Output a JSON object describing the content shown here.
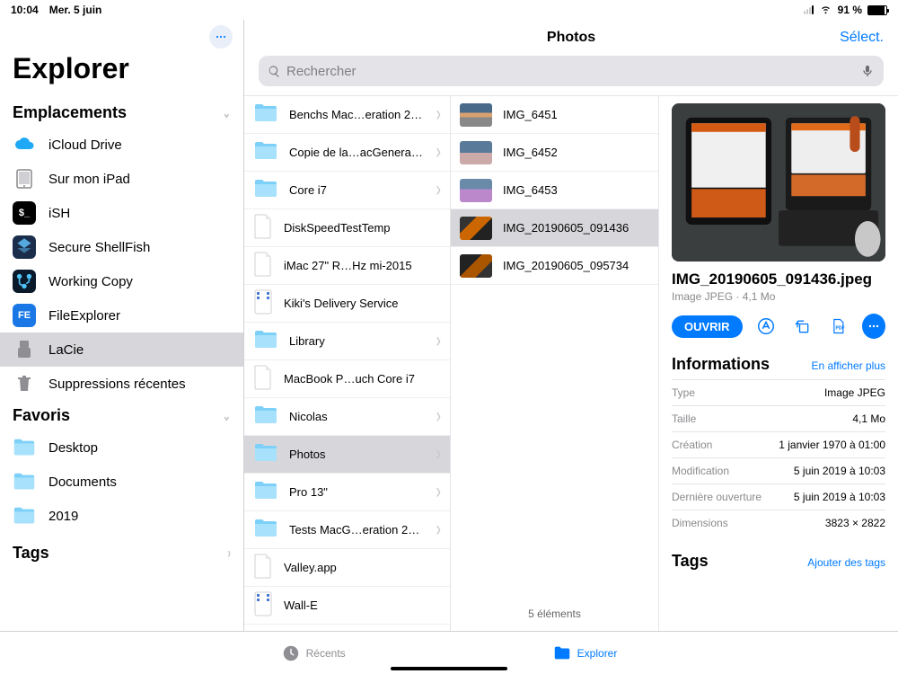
{
  "status": {
    "time": "10:04",
    "date": "Mer. 5 juin",
    "battery_pct": "91 %"
  },
  "sidebar": {
    "title": "Explorer",
    "locations_label": "Emplacements",
    "favorites_label": "Favoris",
    "tags_label": "Tags",
    "locations": [
      {
        "label": "iCloud Drive",
        "icon": "cloud"
      },
      {
        "label": "Sur mon iPad",
        "icon": "ipad"
      },
      {
        "label": "iSH",
        "icon": "ish"
      },
      {
        "label": "Secure ShellFish",
        "icon": "shellfish"
      },
      {
        "label": "Working Copy",
        "icon": "working-copy"
      },
      {
        "label": "FileExplorer",
        "icon": "fe"
      },
      {
        "label": "LaCie",
        "icon": "usb",
        "selected": true
      },
      {
        "label": "Suppressions récentes",
        "icon": "trash"
      }
    ],
    "favorites": [
      {
        "label": "Desktop"
      },
      {
        "label": "Documents"
      },
      {
        "label": "2019"
      }
    ]
  },
  "header": {
    "title": "Photos",
    "select": "Sélect.",
    "search_placeholder": "Rechercher"
  },
  "column1": [
    {
      "label": "Benchs Mac…eration 2011",
      "type": "folder"
    },
    {
      "label": "Copie de la…acGeneration",
      "type": "folder"
    },
    {
      "label": "Core i7",
      "type": "folder"
    },
    {
      "label": "DiskSpeedTestTemp",
      "type": "file"
    },
    {
      "label": "iMac 27\" R…Hz mi-2015",
      "type": "file"
    },
    {
      "label": "Kiki's Delivery Service",
      "type": "video"
    },
    {
      "label": "Library",
      "type": "folder"
    },
    {
      "label": "MacBook P…uch Core i7",
      "type": "file"
    },
    {
      "label": "Nicolas",
      "type": "folder"
    },
    {
      "label": "Photos",
      "type": "folder",
      "selected": true
    },
    {
      "label": "Pro 13\"",
      "type": "folder"
    },
    {
      "label": "Tests MacG…eration 2014",
      "type": "folder"
    },
    {
      "label": "Valley.app",
      "type": "file"
    },
    {
      "label": "Wall-E",
      "type": "video"
    }
  ],
  "column2": [
    {
      "label": "IMG_6451"
    },
    {
      "label": "IMG_6452"
    },
    {
      "label": "IMG_6453"
    },
    {
      "label": "IMG_20190605_091436",
      "selected": true
    },
    {
      "label": "IMG_20190605_095734"
    }
  ],
  "column2_footer": "5 éléments",
  "detail": {
    "filename": "IMG_20190605_091436.jpeg",
    "subtitle": "Image JPEG · 4,1 Mo",
    "open_label": "OUVRIR",
    "info_title": "Informations",
    "info_more": "En afficher plus",
    "rows": [
      {
        "k": "Type",
        "v": "Image JPEG"
      },
      {
        "k": "Taille",
        "v": "4,1 Mo"
      },
      {
        "k": "Création",
        "v": "1 janvier 1970 à 01:00"
      },
      {
        "k": "Modification",
        "v": "5 juin 2019 à 10:03"
      },
      {
        "k": "Dernière ouverture",
        "v": "5 juin 2019 à 10:03"
      },
      {
        "k": "Dimensions",
        "v": "3823 × 2822"
      }
    ],
    "tags_title": "Tags",
    "tags_add": "Ajouter des tags"
  },
  "tabs": {
    "recents": "Récents",
    "browse": "Explorer"
  }
}
